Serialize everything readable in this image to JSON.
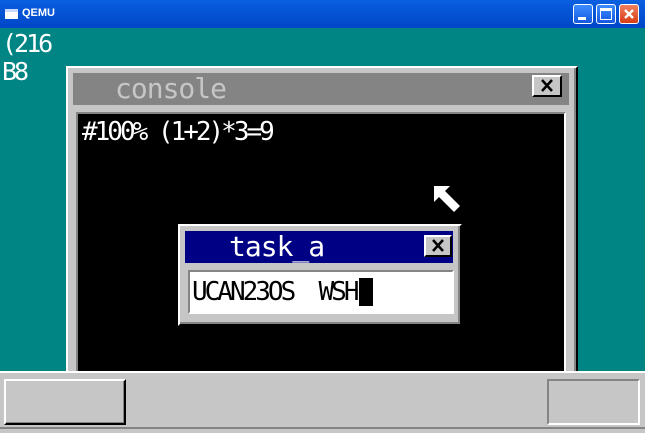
{
  "host_window": {
    "title": "QEMU",
    "icons": [
      "window-icon",
      "minimize-icon",
      "maximize-icon",
      "close-icon"
    ]
  },
  "desktop": {
    "lines": [
      "(216",
      "B8"
    ]
  },
  "console": {
    "title": "console",
    "output": "#100% (1+2)*3=9",
    "icons": [
      "close-icon",
      "mouse-pointer-icon"
    ]
  },
  "task_a": {
    "title": "task_a",
    "input_value": "UCAN23OS  WSH"
  },
  "colors": {
    "desktop": "#008484",
    "window_face": "#c6c6c6",
    "active_title": "#000084",
    "inactive_title": "#848484",
    "host_title": "#0046c8"
  }
}
